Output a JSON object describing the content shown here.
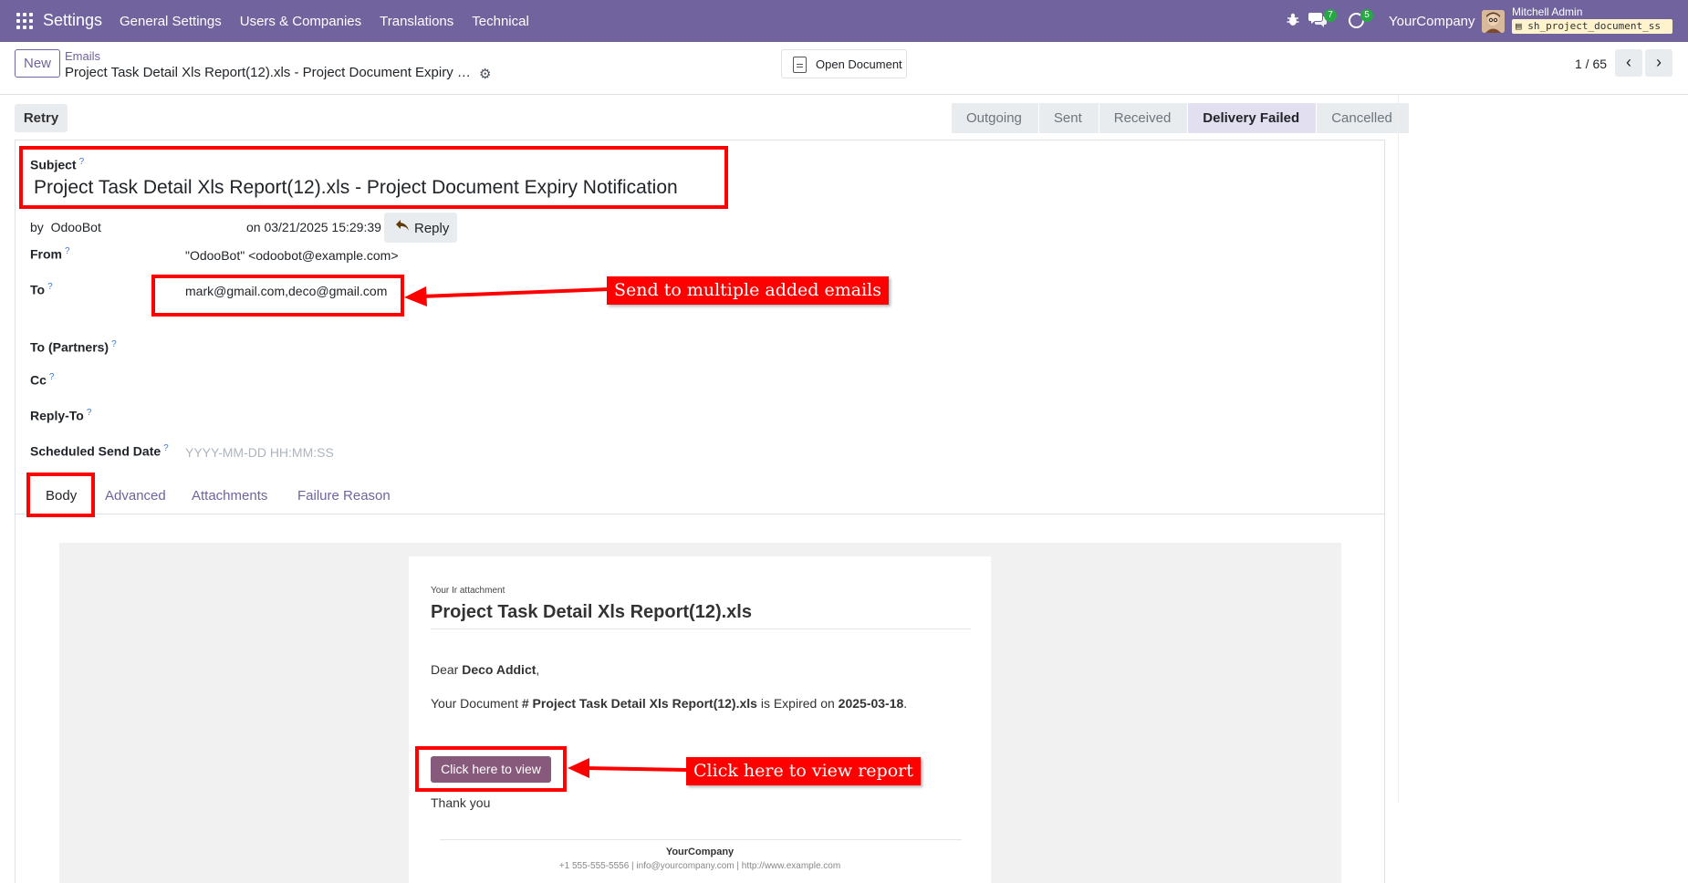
{
  "navbar": {
    "brand": "Settings",
    "menu": [
      "General Settings",
      "Users & Companies",
      "Translations",
      "Technical"
    ],
    "chat_badge": "7",
    "activity_badge": "5",
    "company": "YourCompany",
    "user_name": "Mitchell Admin",
    "db_name": "sh_project_document_ss",
    "accent_color": "#71639e"
  },
  "control": {
    "new_label": "New",
    "breadcrumb_parent": "Emails",
    "breadcrumb_current": "Project Task Detail Xls Report(12).xls - Project Document Expiry Notification",
    "open_document_label": "Open Document",
    "pager": "1 / 65"
  },
  "statusbar": {
    "retry_label": "Retry",
    "stages": [
      "Outgoing",
      "Sent",
      "Received",
      "Delivery Failed",
      "Cancelled"
    ],
    "active_stage": "Delivery Failed"
  },
  "form": {
    "subject_label": "Subject",
    "help_mark": "?",
    "subject_value": "Project Task Detail Xls Report(12).xls - Project Document Expiry Notification",
    "by_text": "by",
    "author": "OdooBot",
    "date_text": "on 03/21/2025 15:29:39",
    "reply_label": "Reply",
    "from_label": "From",
    "from_value": "\"OdooBot\" <odoobot@example.com>",
    "to_label": "To",
    "to_value": "mark@gmail.com,deco@gmail.com",
    "to_partners_label": "To (Partners)",
    "cc_label": "Cc",
    "reply_to_label": "Reply-To",
    "scheduled_label": "Scheduled Send Date",
    "scheduled_placeholder": "YYYY-MM-DD HH:MM:SS"
  },
  "tabs": [
    "Body",
    "Advanced",
    "Attachments",
    "Failure Reason"
  ],
  "mail_body": {
    "small_header": "Your Ir attachment",
    "title": "Project Task Detail Xls Report(12).xls",
    "greeting_prefix": "Dear ",
    "greeting_name": "Deco Addict",
    "greeting_suffix": ",",
    "doc_prefix": "Your Document ",
    "doc_name": "# Project Task Detail Xls Report(12).xls",
    "doc_middle": " is Expired on ",
    "doc_date": "2025-03-18",
    "doc_suffix": ".",
    "button_label": "Click here to view",
    "thanks": "Thank you",
    "company": "YourCompany",
    "contact": "+1 555-555-5556 | info@yourcompany.com | http://www.example.com"
  },
  "annotations": {
    "to_callout": "Send to multiple added emails",
    "view_callout": "Click here to view report",
    "highlight_color": "#ff0000"
  }
}
